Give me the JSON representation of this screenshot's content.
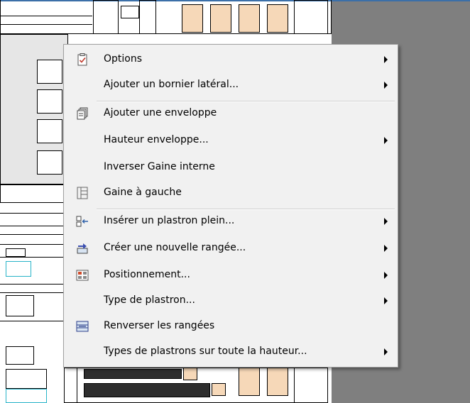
{
  "menu": {
    "items": [
      {
        "label": "Options",
        "icon": "clipboard-check-icon",
        "submenu": true
      },
      {
        "label": "Ajouter un bornier latéral...",
        "icon": null,
        "submenu": true
      },
      {
        "label": "Ajouter une enveloppe",
        "icon": "documents-stack-icon",
        "submenu": false
      },
      {
        "label": "Hauteur enveloppe...",
        "icon": null,
        "submenu": true
      },
      {
        "label": "Inverser Gaine interne",
        "icon": null,
        "submenu": false
      },
      {
        "label": "Gaine à gauche",
        "icon": "left-duct-icon",
        "submenu": false
      },
      {
        "label": "Insérer un plastron plein...",
        "icon": "insert-plate-icon",
        "submenu": true
      },
      {
        "label": "Créer une nouvelle rangée...",
        "icon": "new-row-icon",
        "submenu": true
      },
      {
        "label": "Positionnement...",
        "icon": "positioning-icon",
        "submenu": true
      },
      {
        "label": "Type de plastron...",
        "icon": null,
        "submenu": true
      },
      {
        "label": "Renverser les rangées",
        "icon": "reverse-rows-icon",
        "submenu": false
      },
      {
        "label": "Types de plastrons sur toute la hauteur...",
        "icon": null,
        "submenu": true
      }
    ]
  },
  "colors": {
    "menu_background": "#f1f1f1",
    "workspace_gray": "#7f7f7f",
    "cabinet_fill": "#f6d8b8",
    "accent_blue": "#3b6fa8"
  }
}
